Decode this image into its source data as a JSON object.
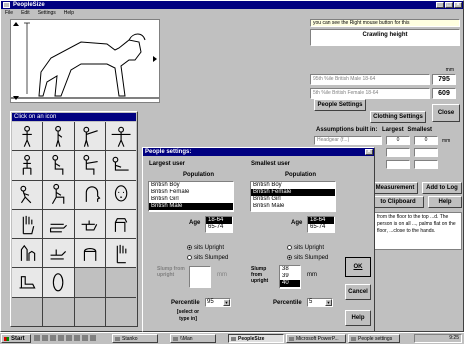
{
  "app": {
    "title": "PeopleSize",
    "menu": [
      "File",
      "Edit",
      "Settings",
      "Help"
    ],
    "minimize": "_",
    "maximize": "□",
    "close": "×"
  },
  "info": {
    "prompt": "you can see the Right mouse button for this",
    "measurement_name": "Crawling height",
    "unit": "mm",
    "value1_label": "95th %ile British Male 18-64",
    "value1": "795",
    "value2_label": "5th %ile British Female 18-64",
    "value2": "609"
  },
  "buttons": {
    "people_settings": "People Settings",
    "clothing_settings": "Clothing Settings",
    "close": "Close",
    "measurement": "Measurement",
    "add_to_log": "Add to Log",
    "to_clipboard": "to Clipboard",
    "help": "Help"
  },
  "assumptions": {
    "label": "Assumptions built in:",
    "largest": "Largest",
    "smallest": "Smallest",
    "row_label": "Headgear (f...)",
    "largest_value": "0",
    "smallest_value": "0",
    "unit": "mm"
  },
  "description": "from the floor to the top ...d. The person is on all ..., palms flat on the floor, ...close to the hands.",
  "grid_panel": {
    "title": "Click on an icon",
    "icons": [
      "standing-front",
      "standing-side",
      "arm-reach",
      "body-span",
      "seated-front",
      "seated-side",
      "seated-reach",
      "seated-legs",
      "crouching",
      "kneeling",
      "head-side",
      "head-front",
      "hand-open",
      "hand-side",
      "hand-point",
      "hand-grip",
      "finger-thumb",
      "hand-hold",
      "hand-fist",
      "hand-back",
      "foot-side",
      "foot-top",
      "",
      "",
      "",
      "",
      "",
      ""
    ]
  },
  "dialog": {
    "title": "People settings:",
    "largest": {
      "heading": "Largest user",
      "population_label": "Population",
      "population": [
        "British Boy",
        "British Female",
        "British Girl",
        "British Male"
      ],
      "population_selected": "British Male",
      "age_label": "Age",
      "ages": [
        "18-64",
        "65-74"
      ],
      "age_selected": "18-64",
      "posture_upright": "sits Upright",
      "posture_slumped": "sits Slumped",
      "posture_selected": "upright",
      "slump_label": "Slump from upright",
      "slump_value": "",
      "slump_unit": "mm",
      "percentile_label": "Percentile",
      "percentile": "95",
      "percentile_note": "[select or type in]"
    },
    "smallest": {
      "heading": "Smallest user",
      "population_label": "Population",
      "population": [
        "British Boy",
        "British Female",
        "British Girl",
        "British Male"
      ],
      "population_selected": "British Female",
      "age_label": "Age",
      "ages": [
        "18-64",
        "65-74"
      ],
      "age_selected": "18-64",
      "posture_upright": "sits Upright",
      "posture_slumped": "sits Slumped",
      "posture_selected": "slumped",
      "slump_label": "Slump from upright",
      "slump_options": [
        "38",
        "39",
        "40"
      ],
      "slump_selected": "40",
      "slump_unit": "mm",
      "percentile_label": "Percentile",
      "percentile": "5"
    },
    "ok": "OK",
    "cancel": "Cancel",
    "help": "Help"
  },
  "taskbar": {
    "start": "Start",
    "tasks": [
      "Stanko",
      "\\\\Man",
      "PeopleSize",
      "Microsoft PowerP...",
      "People settings"
    ],
    "active_task": "PeopleSize",
    "clock": "9:25"
  }
}
